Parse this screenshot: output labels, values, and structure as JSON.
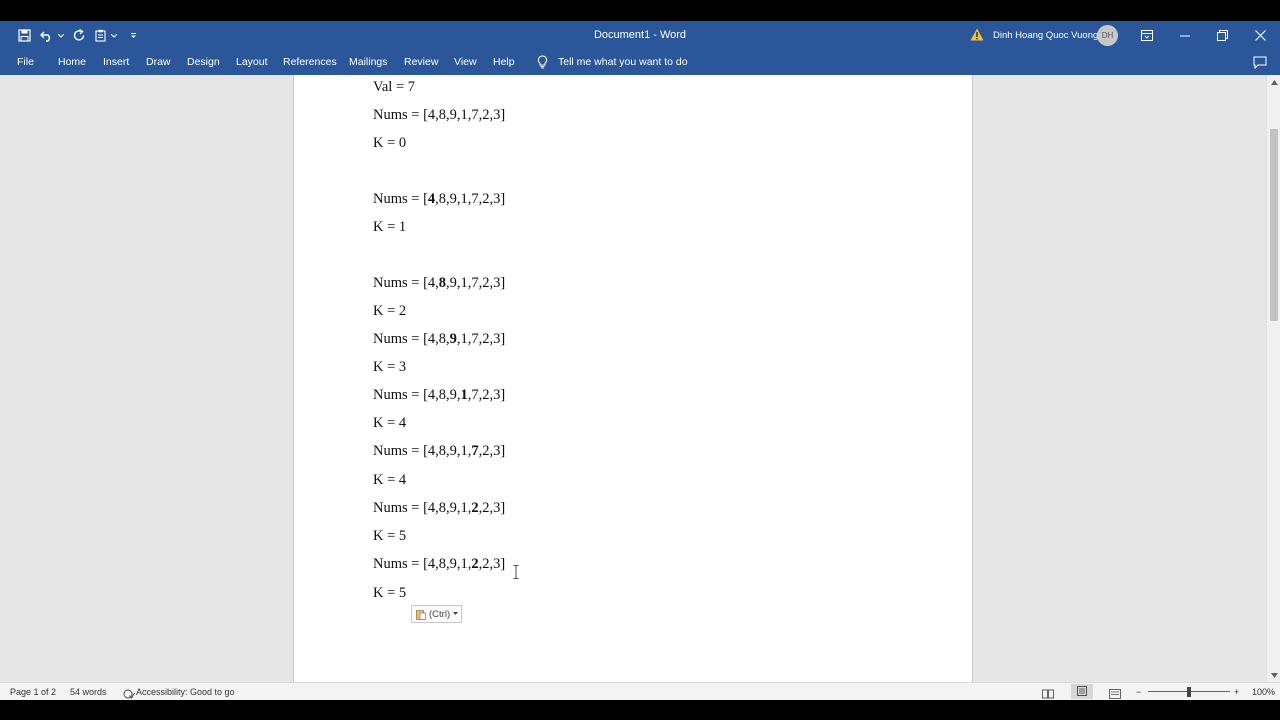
{
  "window": {
    "doc_title": "Document1  -  Word",
    "user_name": "Dinh Hoang Quoc Vuong",
    "user_initials": "DH"
  },
  "menu": {
    "items": [
      "File",
      "Home",
      "Insert",
      "Draw",
      "Design",
      "Layout",
      "References",
      "Mailings",
      "Review",
      "View",
      "Help"
    ],
    "tell_me": "Tell me what you want to do"
  },
  "document": {
    "lines": [
      {
        "text": "Val = 7"
      },
      {
        "text": "Nums = [4,8,9,1,7,2,3]"
      },
      {
        "text": "K = 0"
      },
      {
        "pre": "Nums = [",
        "bold": "4",
        "post": ",8,9,1,7,2,3]"
      },
      {
        "text": "K = 1"
      },
      {
        "pre": "Nums = [4,",
        "bold": "8",
        "post": ",9,1,7,2,3]"
      },
      {
        "text": "K = 2"
      },
      {
        "pre": "Nums = [4,8,",
        "bold": "9",
        "post": ",1,7,2,3]"
      },
      {
        "text": "K = 3"
      },
      {
        "pre": "Nums = [4,8,9,",
        "bold": "1",
        "post": ",7,2,3]"
      },
      {
        "text": "K = 4"
      },
      {
        "pre": "Nums = [4,8,9,1,",
        "bold": "7",
        "post": ",2,3]"
      },
      {
        "text": "K = 4"
      },
      {
        "pre": "Nums = [4,8,9,1,",
        "bold": "2",
        "post": ",2,3]"
      },
      {
        "text": "K = 5"
      },
      {
        "pre": "Nums = [4,8,9,1,",
        "bold": "2",
        "post": ",2,3]"
      },
      {
        "text": "K = 5"
      }
    ],
    "paste_label": "(Ctrl)"
  },
  "status": {
    "page": "Page 1 of 2",
    "words": "54 words",
    "accessibility": "Accessibility: Good to go",
    "zoom": "100%"
  },
  "colors": {
    "ribbon": "#2b579a",
    "canvas": "#e6e6e6"
  }
}
